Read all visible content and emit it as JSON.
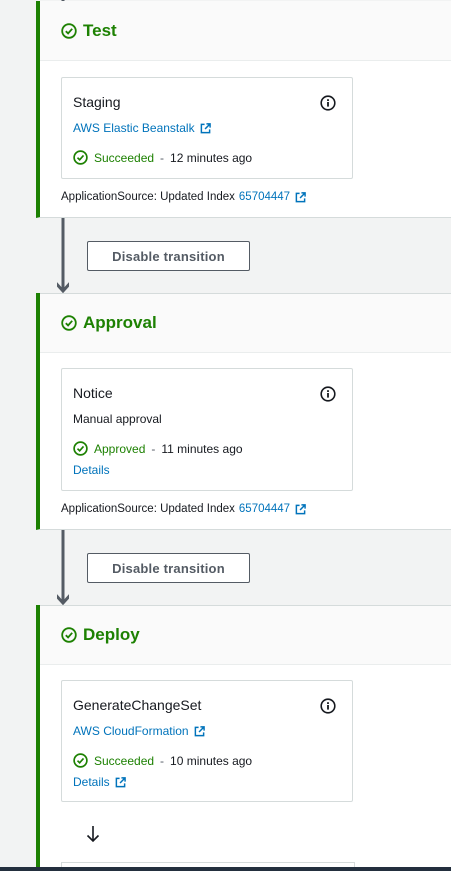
{
  "stages": [
    {
      "title": "Test",
      "action": {
        "name": "Staging",
        "provider": "AWS Elastic Beanstalk",
        "status": "Succeeded",
        "separator": "-",
        "time": "12 minutes ago"
      },
      "source_label": "ApplicationSource: Updated Index",
      "source_link": "65704447"
    },
    {
      "title": "Approval",
      "action": {
        "name": "Notice",
        "provider": "Manual approval",
        "status": "Approved",
        "separator": "-",
        "time": "11 minutes ago",
        "details": "Details"
      },
      "source_label": "ApplicationSource: Updated Index",
      "source_link": "65704447"
    },
    {
      "title": "Deploy",
      "action": {
        "name": "GenerateChangeSet",
        "provider": "AWS CloudFormation",
        "status": "Succeeded",
        "separator": "-",
        "time": "10 minutes ago",
        "details": "Details"
      }
    }
  ],
  "transitions": [
    {
      "button_label": "Disable transition"
    },
    {
      "button_label": "Disable transition"
    }
  ],
  "colors": {
    "success": "#1d8102",
    "link": "#0073bb",
    "arrow": "#545b64"
  },
  "icons": [
    "check-circle-icon",
    "info-icon",
    "external-link-icon",
    "arrow-down-icon"
  ]
}
